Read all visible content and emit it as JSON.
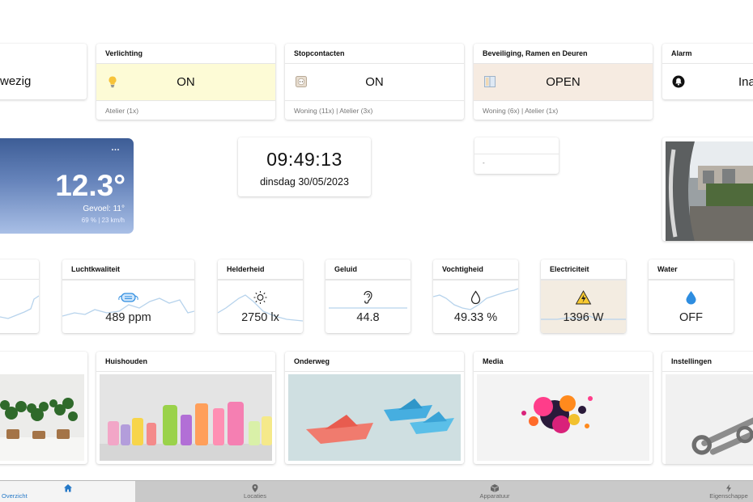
{
  "status_cards": {
    "aanwezig": {
      "value": "wezig"
    },
    "verlichting": {
      "title": "Verlichting",
      "value": "ON",
      "footer": "Atelier (1x)",
      "icon": "lightbulb-icon",
      "bg": "#fdfbd6"
    },
    "stopcontacten": {
      "title": "Stopcontacten",
      "value": "ON",
      "footer": "Woning (11x) | Atelier (3x)",
      "icon": "power-outlet-icon"
    },
    "beveiliging": {
      "title": "Beveiliging, Ramen en Deuren",
      "value": "OPEN",
      "footer": "Woning (6x) | Atelier (1x)",
      "icon": "window-icon",
      "bg": "#f6ebe1"
    },
    "alarm": {
      "title": "Alarm",
      "value": "Ina",
      "icon": "bell-icon"
    }
  },
  "weather": {
    "menu": "…",
    "temperature": "12.3°",
    "feels_like": "Gevoel: 11°",
    "details": "69 % | 23 km/h"
  },
  "clock": {
    "time": "09:49:13",
    "date": "dinsdag 30/05/2023"
  },
  "small_card": {
    "value": "-"
  },
  "sensors": {
    "luchtkwaliteit": {
      "title": "Luchtkwaliteit",
      "value": "489 ppm",
      "icon": "air-mask-icon"
    },
    "helderheid": {
      "title": "Helderheid",
      "value": "2750 lx",
      "icon": "sun-icon"
    },
    "geluid": {
      "title": "Geluid",
      "value": "44.8",
      "icon": "ear-icon"
    },
    "vochtigheid": {
      "title": "Vochtigheid",
      "value": "49.33 %",
      "icon": "droplet-icon"
    },
    "electriciteit": {
      "title": "Electriciteit",
      "value": "1396 W",
      "icon": "high-voltage-icon",
      "bg": "#f3ece1"
    },
    "water": {
      "title": "Water",
      "value": "OFF",
      "icon": "water-drop-icon"
    }
  },
  "categories": {
    "huishouden": {
      "title": "Huishouden"
    },
    "onderweg": {
      "title": "Onderweg"
    },
    "media": {
      "title": "Media"
    },
    "instellingen": {
      "title": "Instellingen"
    }
  },
  "nav": {
    "overzicht": "Overzicht",
    "locaties": "Locaties",
    "apparatuur": "Apparatuur",
    "eigenschappen": "Eigenschappe"
  },
  "colors": {
    "accent": "#2478c7",
    "sparkline": "#b7d3ec",
    "weather_top": "#3d5d96",
    "weather_bottom": "#a9bfe6"
  }
}
